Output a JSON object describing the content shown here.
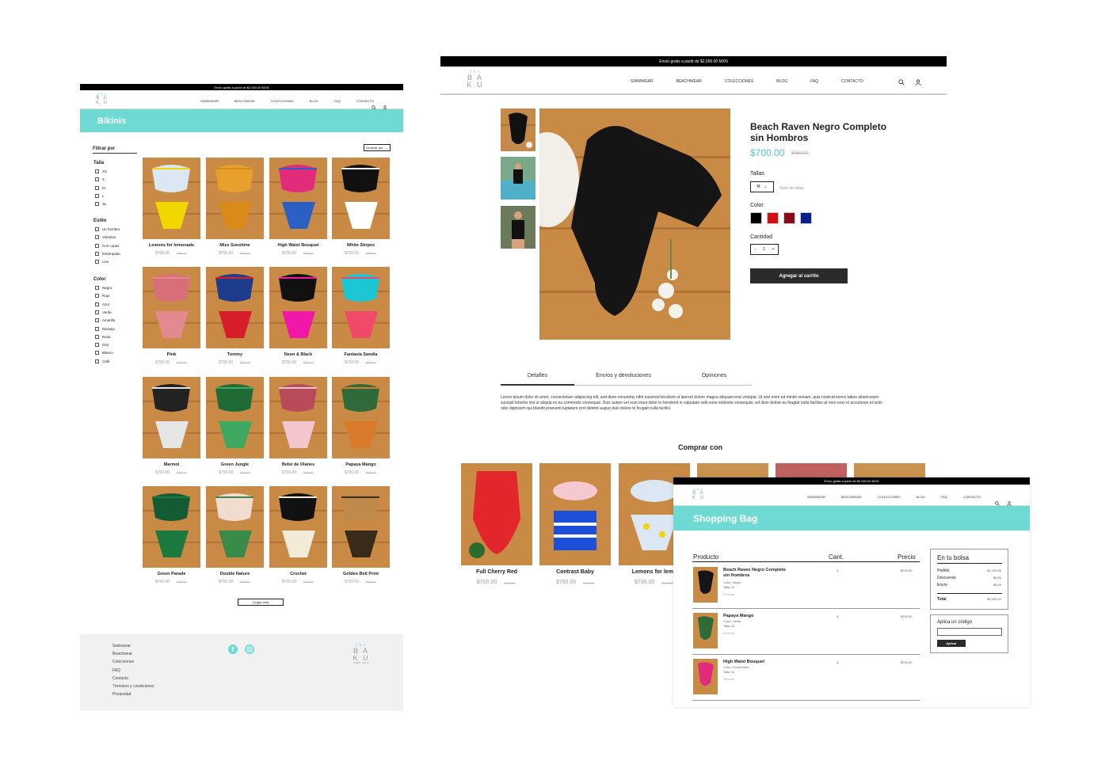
{
  "shop": {
    "topbar": "Envío gratis a partir de $2,000.00 MXN",
    "logo": {
      "script": "The",
      "line1": "B A",
      "line2": "K U",
      "tagline": "SWIM · SHOP"
    },
    "nav": [
      "SWIMWEAR",
      "BEACHWEAR",
      "COLECCIONES",
      "BLOG",
      "FAQ",
      "CONTACTO"
    ],
    "title": "Bikinis",
    "filter": {
      "heading": "Filtrar por",
      "sort_label": "Ordenar por",
      "groups": [
        {
          "name": "Talla",
          "options": [
            "XS",
            "S",
            "M",
            "L",
            "XL"
          ]
        },
        {
          "name": "Estilo",
          "options": [
            "Un hombro",
            "Volantes",
            "Con copas",
            "Estampado",
            "Liso"
          ]
        },
        {
          "name": "Color",
          "options": [
            "Negro",
            "Rojo",
            "Azul",
            "Verde",
            "Amarillo",
            "Naranja",
            "Rosa",
            "Gris",
            "Blanco",
            "Café"
          ]
        }
      ]
    },
    "products": [
      {
        "name": "Lemons for lemonade",
        "price": "$700.00",
        "old": "$959.00"
      },
      {
        "name": "Miss Sunshine",
        "price": "$700.00",
        "old": "$959.00"
      },
      {
        "name": "High Waist Bouquet",
        "price": "$700.00",
        "old": "$959.00"
      },
      {
        "name": "White Stripes",
        "price": "$700.00",
        "old": "$959.00"
      },
      {
        "name": "Pink",
        "price": "$700.00",
        "old": "$959.00"
      },
      {
        "name": "Tommy",
        "price": "$700.00",
        "old": "$959.00"
      },
      {
        "name": "Neon & Black",
        "price": "$700.00",
        "old": "$959.00"
      },
      {
        "name": "Fantasía Sandía",
        "price": "$700.00",
        "old": "$959.00"
      },
      {
        "name": "Marmol",
        "price": "$700.00",
        "old": "$959.00"
      },
      {
        "name": "Green Jungle",
        "price": "$700.00",
        "old": "$959.00"
      },
      {
        "name": "Bebé de Olanes",
        "price": "$700.00",
        "old": "$959.00"
      },
      {
        "name": "Papaya Mango",
        "price": "$700.00",
        "old": "$959.00"
      },
      {
        "name": "Green Parade",
        "price": "$700.00",
        "old": "$959.00"
      },
      {
        "name": "Double Nature",
        "price": "$700.00",
        "old": "$959.00"
      },
      {
        "name": "Crochet",
        "price": "$700.00",
        "old": "$959.00"
      },
      {
        "name": "Golden Belt Print",
        "price": "$700.00",
        "old": "$959.00"
      }
    ],
    "load_more": "Cargar más",
    "footer_links": [
      "Swimwear",
      "Beachwear",
      "Colecciones",
      "FAQ",
      "Contacto",
      "Términos y condiciones",
      "Privacidad"
    ]
  },
  "product": {
    "title": "Beach Raven Negro Completo sin Hombros",
    "price": "$700.00",
    "old_price": "$959.00",
    "sizes_label": "Tallas",
    "size_value": "M",
    "size_guide": "Guía de tallas",
    "color_label": "Color",
    "colors": [
      "#000000",
      "#d40f0f",
      "#8a0a1c",
      "#0a1f8a"
    ],
    "qty_label": "Cantidad",
    "qty_value": "1",
    "qty_minus": "-",
    "qty_plus": "+",
    "add_to_cart": "Agregar al carrito",
    "tabs": [
      "Detalles",
      "Envíos y devoluciones",
      "Opiniones"
    ],
    "description": "Lorem ipsum dolor sit amet, consectetuer adipiscing elit, sed diam nonummy nibh euismod tincidunt ut laoreet dolore magna aliquam erat volutpat. Ut wisi enim ad minim veniam, quis nostrud exerci tation ullamcorper suscipit lobortis nisl ut aliquip ex ea commodo consequat. Duis autem vel eum iriure dolor in hendrerit in vulputate velit esse molestie consequat, vel illum dolore eu feugiat nulla facilisis at vero eros et accumsan et iusto odio dignissim qui blandit praesent luptatum zzril delenit augue duis dolore te feugait nulla facilisi.",
    "related_title": "Comprar con",
    "related": [
      {
        "name": "Full Cherry Red",
        "price": "$700.00",
        "old": "$959.00"
      },
      {
        "name": "Contrast Baby",
        "price": "$700.00",
        "old": "$959.00"
      },
      {
        "name": "Lemons for lemo",
        "price": "$700.00",
        "old": "$959.00"
      }
    ]
  },
  "cart": {
    "title": "Shopping Bag",
    "headers": {
      "product": "Producto",
      "qty": "Cant.",
      "price": "Precio"
    },
    "items": [
      {
        "name": "Beach Raven Negro Completo sin Hombros",
        "color": "Color: Negro",
        "size": "Talla: M",
        "remove": "Eliminar",
        "qty": "1",
        "price": "$700.00"
      },
      {
        "name": "Papaya Mango",
        "color": "Color: Verde",
        "size": "Talla: M",
        "remove": "Eliminar",
        "qty": "1",
        "price": "$700.00"
      },
      {
        "name": "High Waist Bouquet",
        "color": "Color: Fucsia Azul",
        "size": "Talla: M",
        "remove": "Eliminar",
        "qty": "1",
        "price": "$700.00"
      }
    ],
    "summary": {
      "title": "En tu bolsa",
      "rows": [
        {
          "label": "Pedido",
          "value": "$2,100.00"
        },
        {
          "label": "Descuento",
          "value": "$0.00"
        },
        {
          "label": "Envío",
          "value": "$0.00"
        }
      ],
      "total_label": "Total",
      "total_value": "$2,100.00"
    },
    "coupon": {
      "title": "Aplica un código",
      "button": "Aplicar"
    }
  },
  "colors": {
    "accent": "#6fd9d3",
    "wood": "#c9924e",
    "dark": "#2b2b2b"
  }
}
